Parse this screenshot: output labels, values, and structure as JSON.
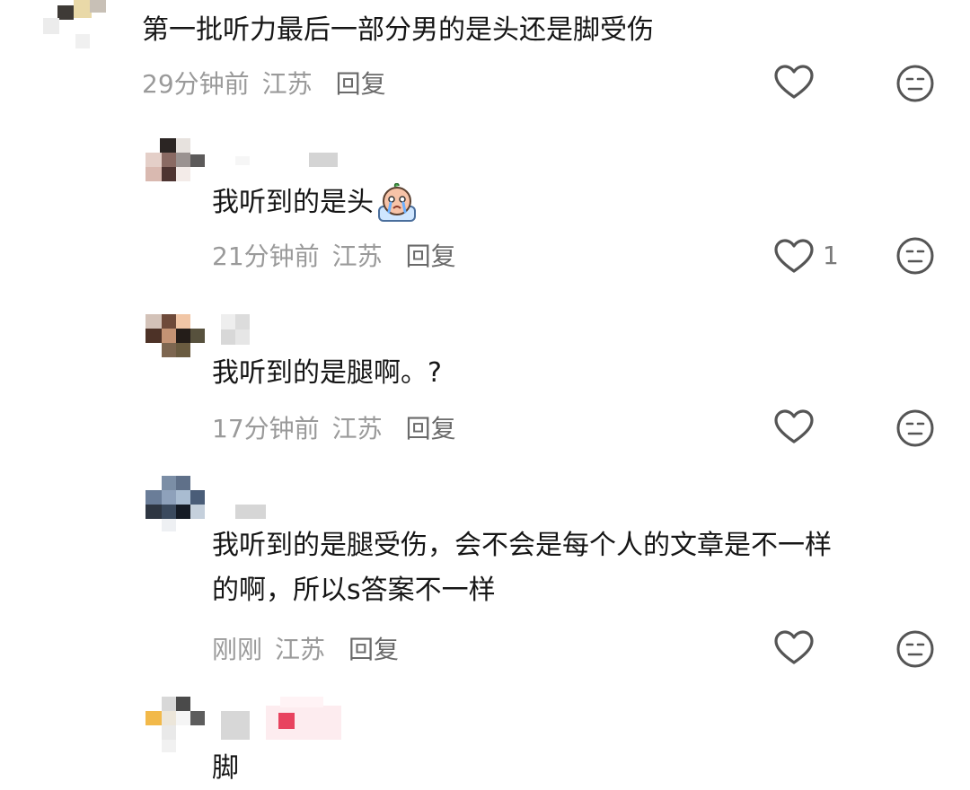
{
  "comments": [
    {
      "text": "第一批听力最后一部分男的是头还是脚受伤",
      "time": "29分钟前",
      "location": "江苏",
      "reply_label": "回复",
      "likes": "",
      "like_icon": "heart-outline-icon",
      "dislike_icon": "neutral-face-icon"
    },
    {
      "text": "我听到的是头",
      "emoji_icon": "crying-face-emoji",
      "time": "21分钟前",
      "location": "江苏",
      "reply_label": "回复",
      "likes": "1",
      "like_icon": "heart-outline-icon",
      "dislike_icon": "neutral-face-icon"
    },
    {
      "text": "我听到的是腿啊。?",
      "time": "17分钟前",
      "location": "江苏",
      "reply_label": "回复",
      "likes": "",
      "like_icon": "heart-outline-icon",
      "dislike_icon": "neutral-face-icon"
    },
    {
      "text_line1": "我听到的是腿受伤，会不会是每个人的文章是不一样",
      "text_line2": "的啊，所以s答案不一样",
      "time": "刚刚",
      "location": "江苏",
      "reply_label": "回复",
      "likes": "",
      "like_icon": "heart-outline-icon",
      "dislike_icon": "neutral-face-icon"
    },
    {
      "text": "脚"
    }
  ],
  "colors": {
    "text": "#161616",
    "meta": "#9a9a9a",
    "reply": "#6a6a6a",
    "icon": "#555555"
  }
}
